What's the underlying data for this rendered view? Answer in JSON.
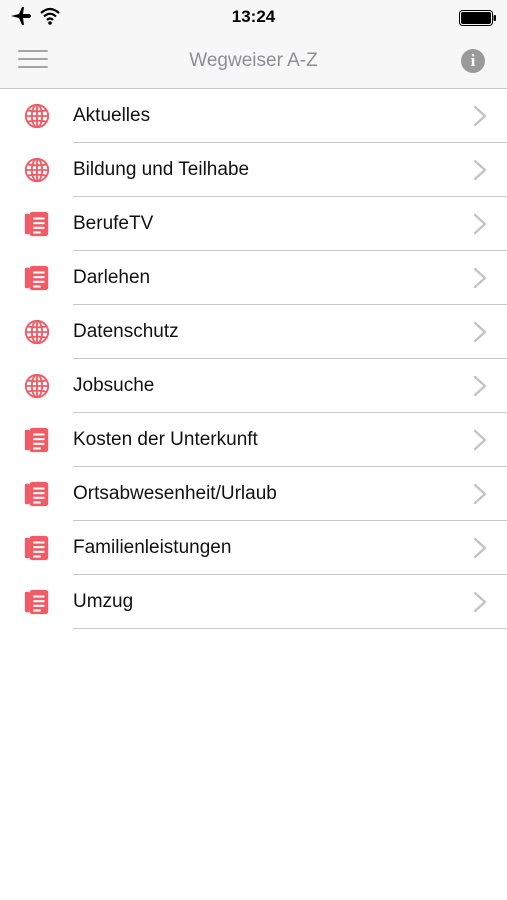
{
  "status_bar": {
    "time": "13:24",
    "left_icons": [
      "airplane-icon",
      "wifi-icon"
    ],
    "right_icon": "battery-icon"
  },
  "nav": {
    "title": "Wegweiser A-Z",
    "left_icon": "menu-icon",
    "right_icon": "info-icon",
    "info_glyph": "i"
  },
  "colors": {
    "accent": "#f05b66",
    "divider": "#c8c8c8",
    "nav_title": "#8e8e93"
  },
  "items": [
    {
      "label": "Aktuelles",
      "icon": "globe-icon"
    },
    {
      "label": "Bildung und Teilhabe",
      "icon": "globe-icon"
    },
    {
      "label": "BerufeTV",
      "icon": "document-icon"
    },
    {
      "label": "Darlehen",
      "icon": "document-icon"
    },
    {
      "label": "Datenschutz",
      "icon": "globe-icon"
    },
    {
      "label": "Jobsuche",
      "icon": "globe-icon"
    },
    {
      "label": "Kosten der Unterkunft",
      "icon": "document-icon"
    },
    {
      "label": "Ortsabwesenheit/Urlaub",
      "icon": "document-icon"
    },
    {
      "label": "Familienleistungen",
      "icon": "document-icon"
    },
    {
      "label": "Umzug",
      "icon": "document-icon"
    }
  ]
}
